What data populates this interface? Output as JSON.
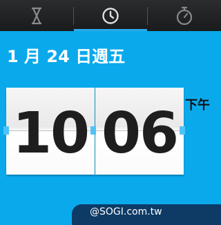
{
  "tabs": [
    {
      "icon": "hourglass-icon",
      "selected": false
    },
    {
      "icon": "clock-icon",
      "selected": true
    },
    {
      "icon": "stopwatch-icon",
      "selected": false
    }
  ],
  "date": "1 月 24 日週五",
  "time": {
    "hour": "10",
    "minute": "06",
    "ampm": "下午"
  },
  "watermark": "@SOGI.com.tw",
  "colors": {
    "background": "#0aa9ec",
    "tabbar": "#1f2021",
    "accent": "#2aa9e8"
  }
}
